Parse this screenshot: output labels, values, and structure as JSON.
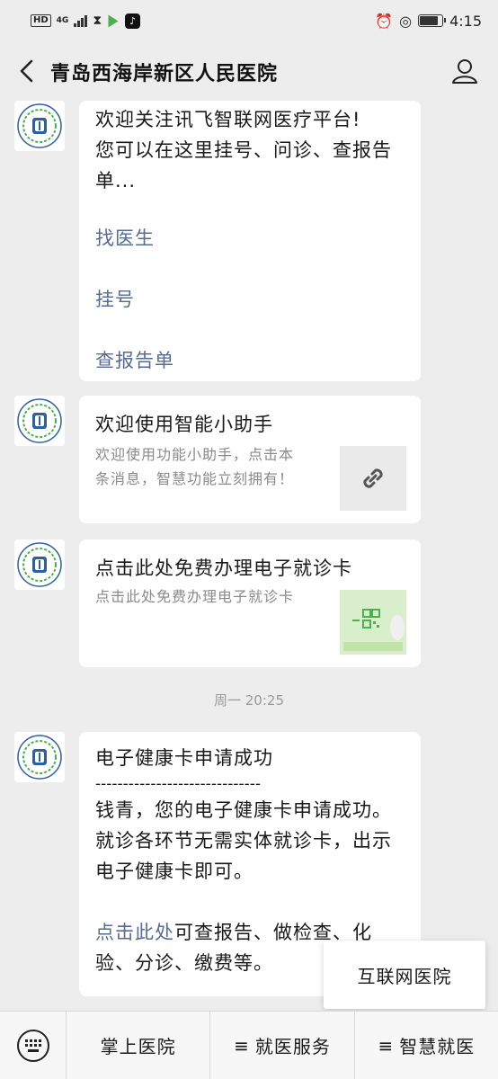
{
  "status_bar": {
    "hd": "HD",
    "network": "4G",
    "time": "4:15"
  },
  "header": {
    "title": "青岛西海岸新区人民医院"
  },
  "messages": {
    "welcome": {
      "line1": "欢迎关注讯飞智联网医疗平台!",
      "line2": "您可以在这里挂号、问诊、查报告",
      "line3": "单...",
      "link1": "找医生",
      "link2": "挂号",
      "link3": "查报告单"
    },
    "assistant_card": {
      "title": "欢迎使用智能小助手",
      "desc_line1": "欢迎使用功能小助手，点击本",
      "desc_line2": "条消息，智慧功能立刻拥有！"
    },
    "ecard": {
      "title": "点击此处免费办理电子就诊卡",
      "desc": "点击此处免费办理电子就诊卡"
    },
    "timestamp": "周一 20:25",
    "health_card": {
      "title": "电子健康卡申请成功",
      "divider": "------------------------------",
      "line1": "钱青，您的电子健康卡申请成功。",
      "line2": "就诊各环节无需实体就诊卡，出示",
      "line3": "电子健康卡即可。",
      "link": "点击此处",
      "line4_rest": "可查报告、做检查、化",
      "line5": "验、分诊、缴费等。"
    }
  },
  "popup": {
    "label": "互联网医院"
  },
  "bottom_menu": {
    "item1": "掌上医院",
    "item2": "就医服务",
    "item3": "智慧就医",
    "menu_marker": "≡"
  },
  "colors": {
    "link": "#576b95",
    "background": "#ededed",
    "bubble": "#ffffff"
  }
}
